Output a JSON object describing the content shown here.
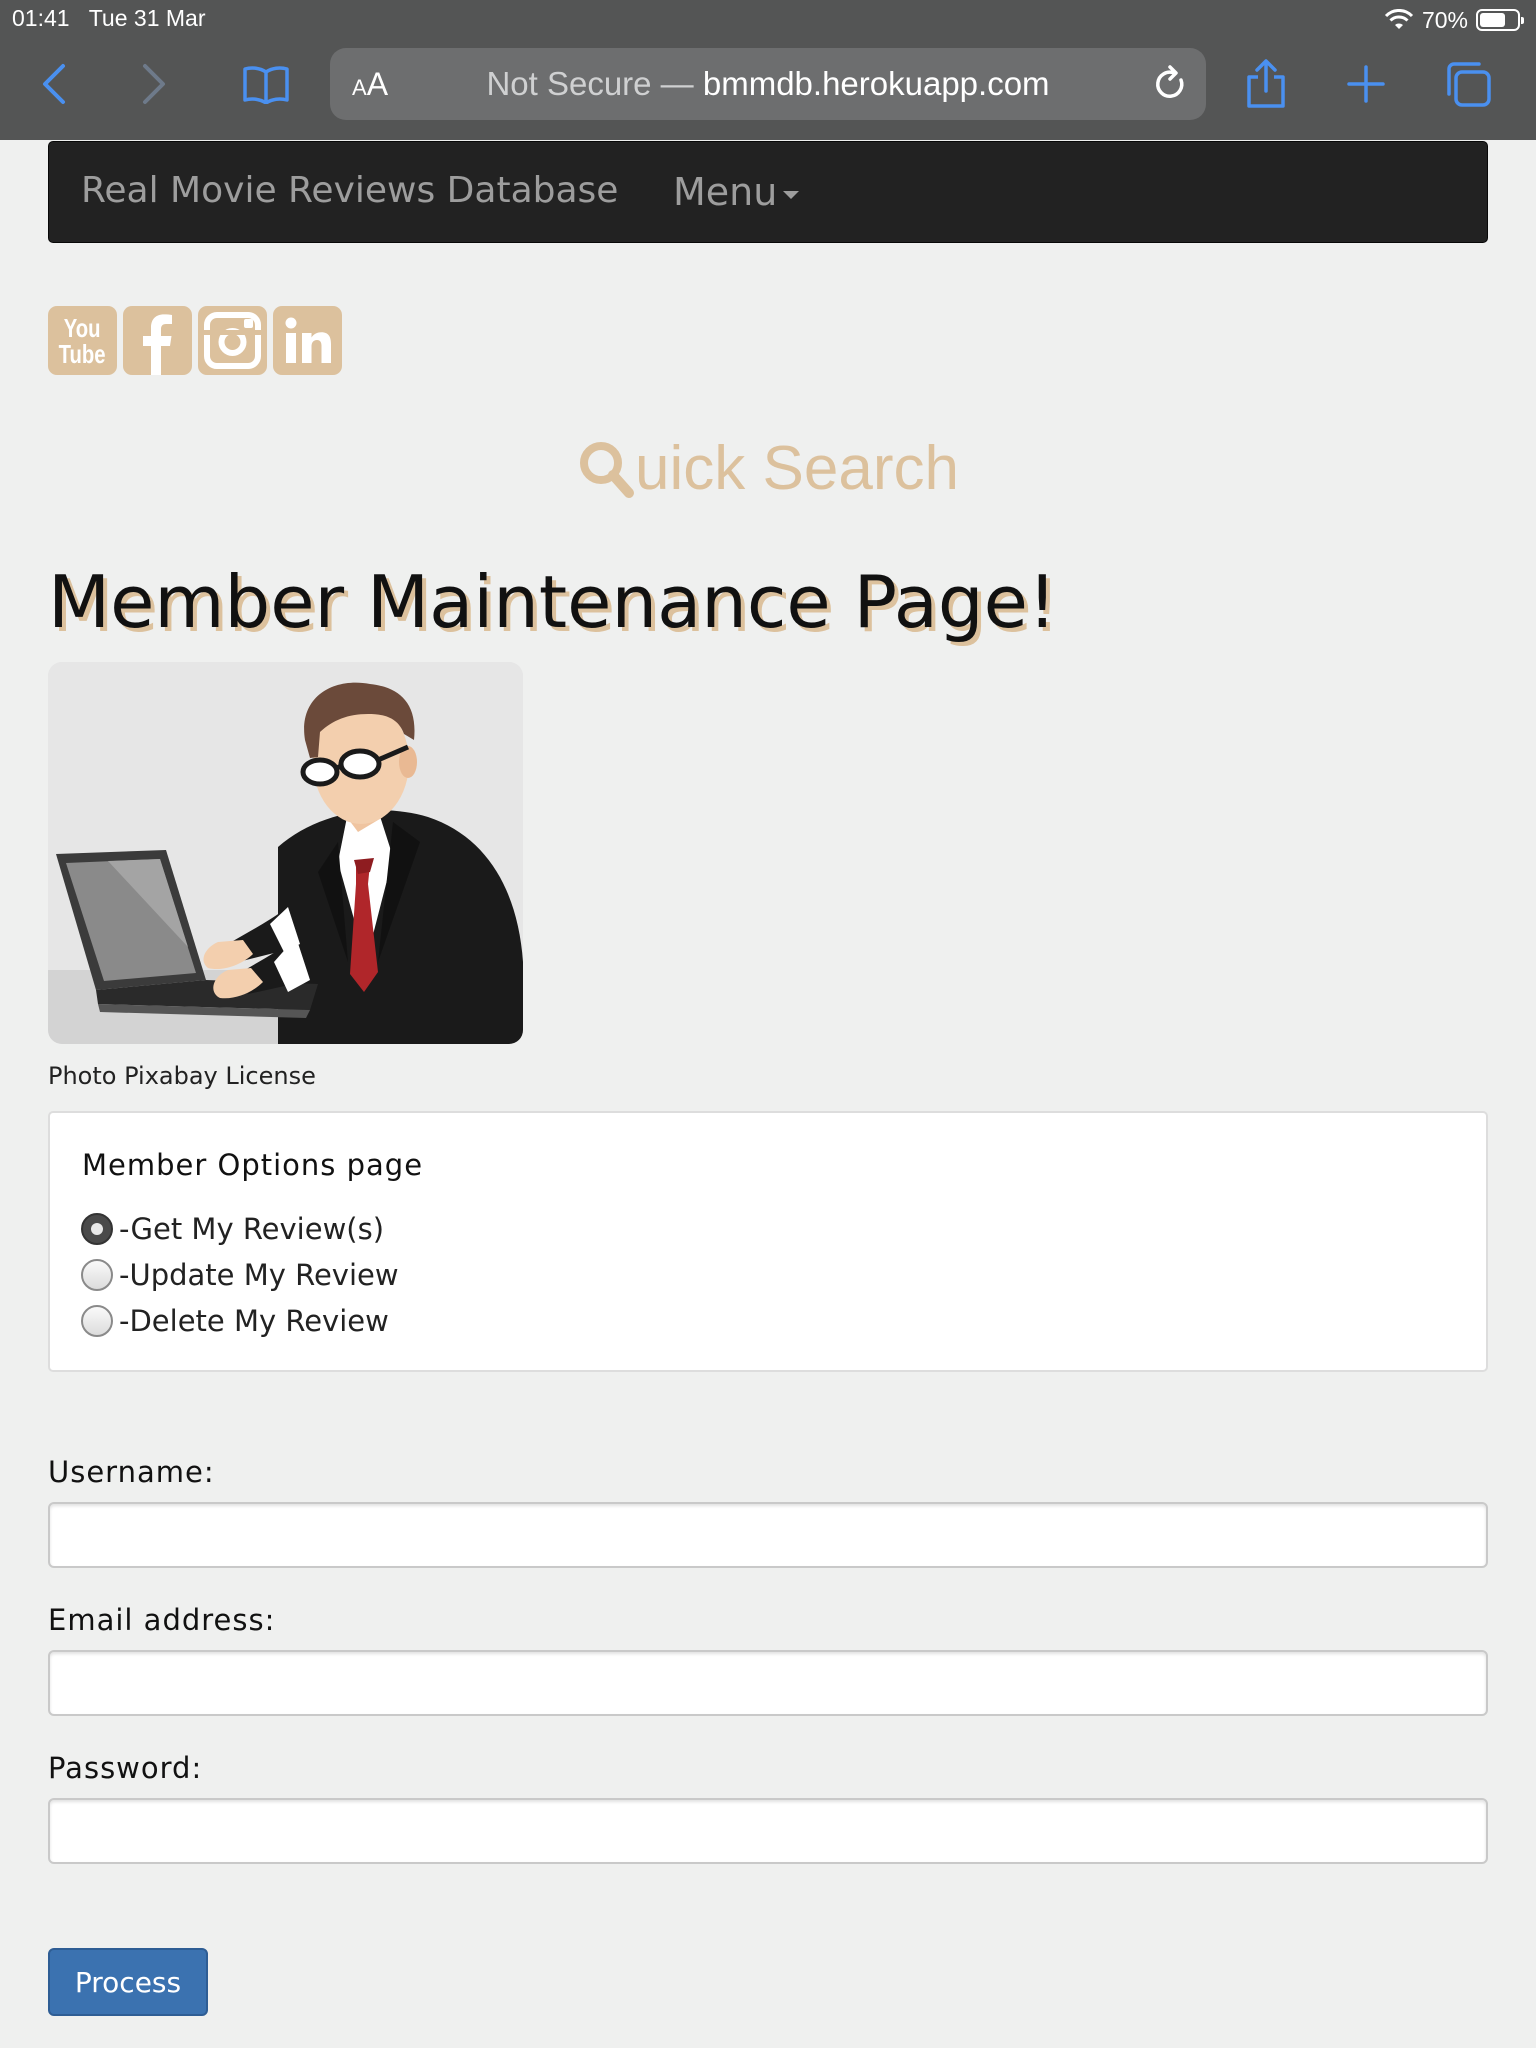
{
  "status_bar": {
    "time": "01:41",
    "date": "Tue 31 Mar",
    "battery": "70%",
    "battery_level": 0.7
  },
  "browser": {
    "text_size_label_small": "A",
    "text_size_label_large": "A",
    "security_label": "Not Secure —",
    "url": "bmmdb.herokuapp.com",
    "accent_color": "#4a90f0"
  },
  "navbar": {
    "brand": "Real Movie Reviews Database",
    "menu_label": "Menu"
  },
  "social": {
    "youtube_top": "You",
    "youtube_bottom": "Tube",
    "icons": [
      "youtube-icon",
      "facebook-icon",
      "instagram-icon",
      "linkedin-icon"
    ],
    "icon_color": "#dcc19d"
  },
  "quick_search": {
    "first_letter": "Q",
    "rest": "uick Search"
  },
  "page": {
    "title": "Member Maintenance Page!",
    "photo_caption": "Photo Pixabay License"
  },
  "options": {
    "heading": "Member Options page",
    "items": [
      {
        "label": "-Get My Review(s)",
        "checked": true
      },
      {
        "label": "-Update My Review",
        "checked": false
      },
      {
        "label": "-Delete My Review",
        "checked": false
      }
    ]
  },
  "form": {
    "username_label": "Username:",
    "username_value": "",
    "email_label": "Email address:",
    "email_value": "",
    "password_label": "Password:",
    "password_value": "",
    "submit_label": "Process"
  }
}
